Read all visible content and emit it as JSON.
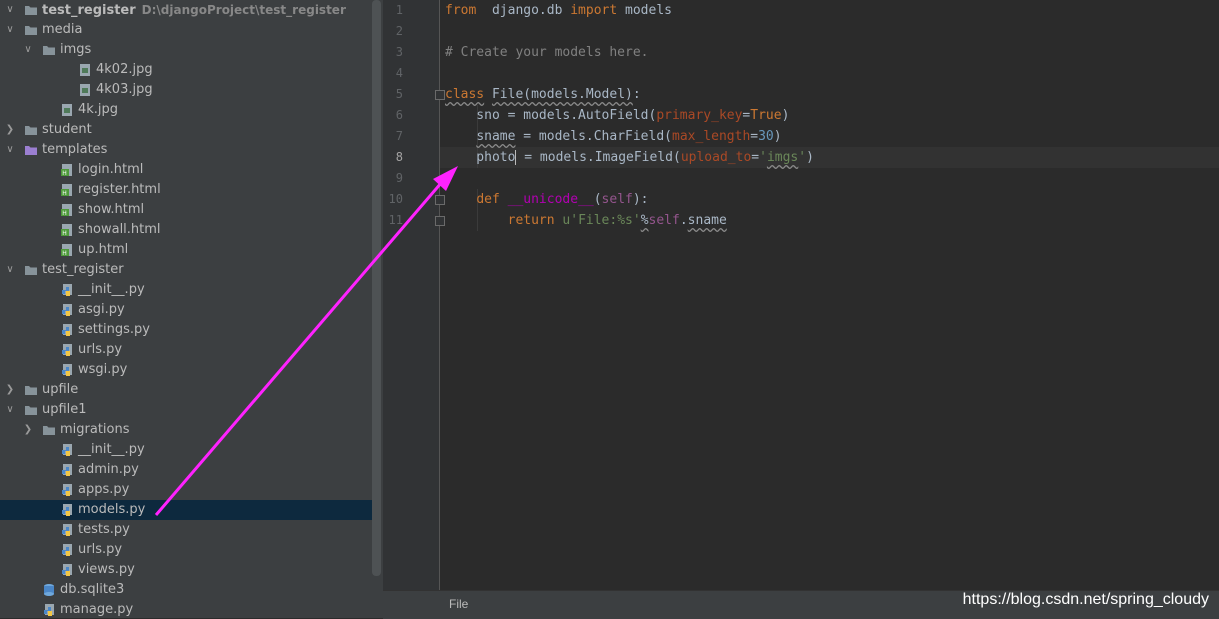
{
  "project_tree": [
    {
      "depth": 0,
      "expanded": true,
      "icon": "folder",
      "label": "test_register",
      "note": "D:\\djangoProject\\test_register",
      "bold": true
    },
    {
      "depth": 0,
      "expanded": true,
      "icon": "folder",
      "label": "media"
    },
    {
      "depth": 1,
      "expanded": true,
      "icon": "folder",
      "label": "imgs"
    },
    {
      "depth": 3,
      "icon": "image",
      "label": "4k02.jpg"
    },
    {
      "depth": 3,
      "icon": "image",
      "label": "4k03.jpg"
    },
    {
      "depth": 2,
      "icon": "image",
      "label": "4k.jpg"
    },
    {
      "depth": 0,
      "expanded": false,
      "icon": "folder",
      "label": "student"
    },
    {
      "depth": 0,
      "expanded": true,
      "icon": "folder-purple",
      "label": "templates"
    },
    {
      "depth": 2,
      "icon": "html",
      "label": "login.html"
    },
    {
      "depth": 2,
      "icon": "html",
      "label": "register.html"
    },
    {
      "depth": 2,
      "icon": "html",
      "label": "show.html"
    },
    {
      "depth": 2,
      "icon": "html",
      "label": "showall.html"
    },
    {
      "depth": 2,
      "icon": "html",
      "label": "up.html"
    },
    {
      "depth": 0,
      "expanded": true,
      "icon": "folder",
      "label": "test_register"
    },
    {
      "depth": 2,
      "icon": "python",
      "label": "__init__.py"
    },
    {
      "depth": 2,
      "icon": "python",
      "label": "asgi.py"
    },
    {
      "depth": 2,
      "icon": "python",
      "label": "settings.py"
    },
    {
      "depth": 2,
      "icon": "python",
      "label": "urls.py"
    },
    {
      "depth": 2,
      "icon": "python",
      "label": "wsgi.py"
    },
    {
      "depth": 0,
      "expanded": false,
      "icon": "folder",
      "label": "upfile"
    },
    {
      "depth": 0,
      "expanded": true,
      "icon": "folder",
      "label": "upfile1"
    },
    {
      "depth": 1,
      "expanded": false,
      "icon": "folder",
      "label": "migrations"
    },
    {
      "depth": 2,
      "icon": "python",
      "label": "__init__.py"
    },
    {
      "depth": 2,
      "icon": "python",
      "label": "admin.py"
    },
    {
      "depth": 2,
      "icon": "python",
      "label": "apps.py"
    },
    {
      "depth": 2,
      "icon": "python",
      "label": "models.py",
      "selected": true
    },
    {
      "depth": 2,
      "icon": "python",
      "label": "tests.py"
    },
    {
      "depth": 2,
      "icon": "python",
      "label": "urls.py"
    },
    {
      "depth": 2,
      "icon": "python",
      "label": "views.py"
    },
    {
      "depth": 1,
      "icon": "database",
      "label": "db.sqlite3"
    },
    {
      "depth": 1,
      "icon": "python",
      "label": "manage.py"
    }
  ],
  "editor": {
    "current_line": 8,
    "lines": [
      {
        "n": "1",
        "tokens": [
          [
            "kw",
            "from"
          ],
          [
            "",
            "  django.db "
          ],
          [
            "kw",
            "import"
          ],
          [
            "",
            " models"
          ]
        ]
      },
      {
        "n": "2",
        "tokens": []
      },
      {
        "n": "3",
        "tokens": [
          [
            "cm",
            "# Create your models here."
          ]
        ]
      },
      {
        "n": "4",
        "tokens": []
      },
      {
        "n": "5",
        "tokens": [
          [
            "kw wavy",
            "class"
          ],
          [
            "",
            " "
          ],
          [
            "wavy",
            "File(models.Model)"
          ],
          [
            "",
            ":"
          ]
        ],
        "fold": true
      },
      {
        "n": "6",
        "tokens": [
          [
            "",
            "    sno = models.AutoField("
          ],
          [
            "param",
            "primary_key"
          ],
          [
            "",
            "="
          ],
          [
            "kw",
            "True"
          ],
          [
            "",
            ")"
          ]
        ]
      },
      {
        "n": "7",
        "tokens": [
          [
            "",
            "    "
          ],
          [
            "wavy",
            "sname"
          ],
          [
            "",
            " = models.CharField("
          ],
          [
            "param",
            "max_length"
          ],
          [
            "",
            "="
          ],
          [
            "num",
            "30"
          ],
          [
            "",
            ")"
          ]
        ]
      },
      {
        "n": "8",
        "tokens": [
          [
            "",
            "    photo"
          ],
          [
            "caret",
            ""
          ],
          [
            "",
            " = models.ImageField("
          ],
          [
            "param",
            "upload_to"
          ],
          [
            "",
            "="
          ],
          [
            "str",
            "'"
          ],
          [
            "str wavy",
            "imgs"
          ],
          [
            "str",
            "'"
          ],
          [
            "",
            ")"
          ]
        ]
      },
      {
        "n": "9",
        "tokens": []
      },
      {
        "n": "10",
        "tokens": [
          [
            "",
            "    "
          ],
          [
            "kw",
            "def "
          ],
          [
            "magic",
            "__unicode__"
          ],
          [
            "",
            "("
          ],
          [
            "self",
            "self"
          ],
          [
            "",
            "):"
          ]
        ],
        "fold": true
      },
      {
        "n": "11",
        "tokens": [
          [
            "",
            "        "
          ],
          [
            "kw",
            "return "
          ],
          [
            "str",
            "u'File:%s'"
          ],
          [
            "wavy",
            "%"
          ],
          [
            "self",
            "self"
          ],
          [
            "",
            "."
          ],
          [
            "wavy",
            "sname"
          ]
        ],
        "fold": true
      }
    ]
  },
  "status": {
    "breadcrumb": "File",
    "watermark": "https://blog.csdn.net/spring_cloudy"
  },
  "colors": {
    "annotation_arrow": "#ff22ff",
    "folder": "#87939a",
    "folder_purple": "#9b7fd1",
    "html_icon": "#4e9a3a",
    "python_blue": "#4a86c7",
    "python_yellow": "#f2c744"
  }
}
